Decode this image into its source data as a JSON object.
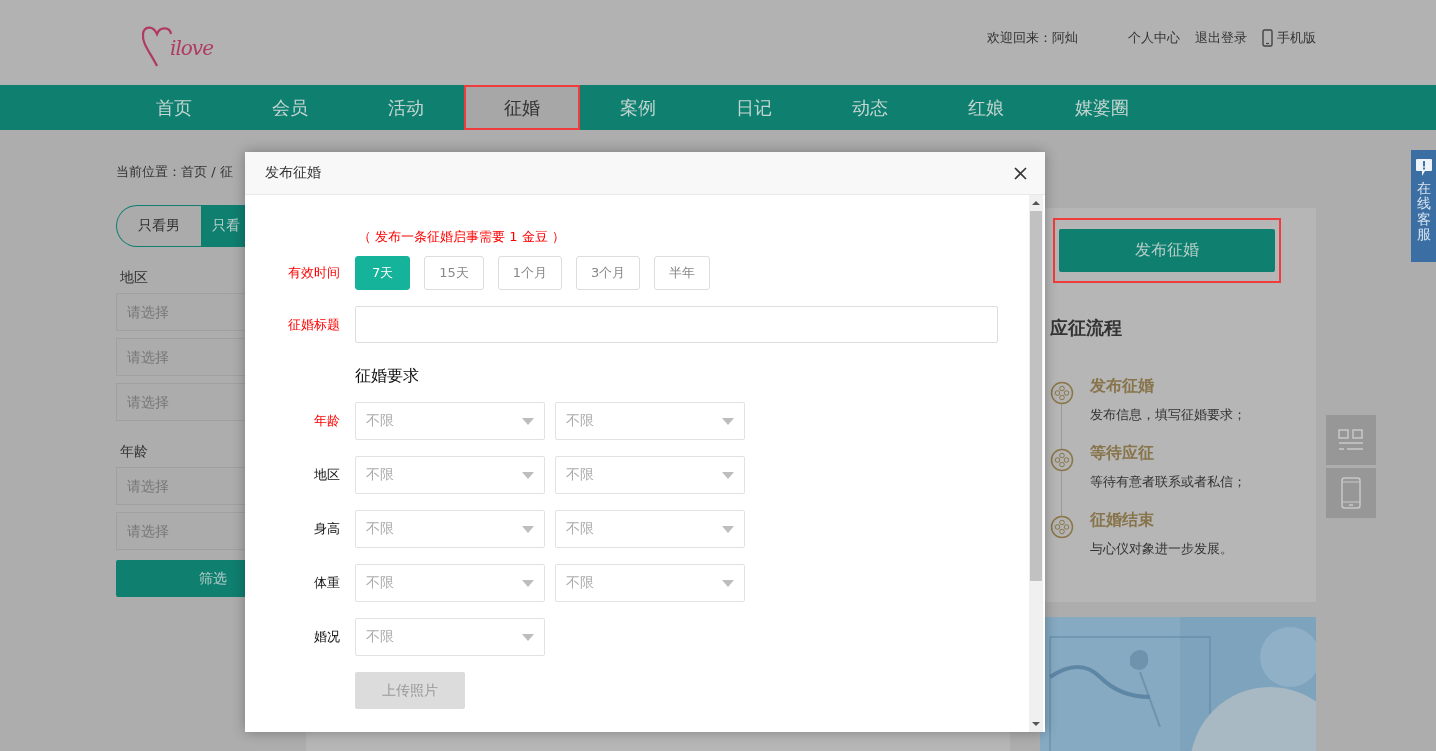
{
  "header": {
    "logo": "ilove",
    "welcome": "欢迎回来：阿灿",
    "links": [
      {
        "label": "个人中心",
        "kind": "text"
      },
      {
        "label": "退出登录",
        "kind": "text"
      },
      {
        "label": "手机版",
        "kind": "mobile"
      }
    ]
  },
  "nav": [
    {
      "label": "首页",
      "selected": false,
      "highlighted": false
    },
    {
      "label": "会员",
      "selected": false,
      "highlighted": false
    },
    {
      "label": "活动",
      "selected": false,
      "highlighted": false
    },
    {
      "label": "征婚",
      "selected": true,
      "highlighted": true
    },
    {
      "label": "案例",
      "selected": false,
      "highlighted": false
    },
    {
      "label": "日记",
      "selected": false,
      "highlighted": false
    },
    {
      "label": "动态",
      "selected": false,
      "highlighted": false
    },
    {
      "label": "红娘",
      "selected": false,
      "highlighted": false
    },
    {
      "label": "媒婆圈",
      "selected": false,
      "highlighted": false
    }
  ],
  "breadcrumb": "当前位置：首页 / 征",
  "filter": {
    "gender_tabs": [
      {
        "label": "只看男",
        "selected": false
      },
      {
        "label": "只看",
        "selected": true
      }
    ],
    "groups": [
      {
        "label": "地区",
        "fields": [
          {
            "placeholder": "请选择"
          },
          {
            "placeholder": "请选择"
          },
          {
            "placeholder": "请选择"
          }
        ]
      },
      {
        "label": "年龄",
        "fields": [
          {
            "placeholder": "请选择"
          },
          {
            "placeholder": "请选择"
          }
        ]
      }
    ],
    "button": "筛选"
  },
  "sidebar": {
    "publish_button": {
      "label": "发布征婚",
      "highlighted": true
    },
    "process_title": "应征流程",
    "steps": [
      {
        "title": "发布征婚",
        "description": "发布信息，填写征婚要求；"
      },
      {
        "title": "等待应征",
        "description": "等待有意者联系或者私信；"
      },
      {
        "title": "征婚结束",
        "description": "与心仪对象进一步发展。"
      }
    ]
  },
  "service_tab": "在线客服",
  "modal": {
    "title": "发布征婚",
    "note": "（ 发布一条征婚启事需要 1 金豆 ）",
    "duration": {
      "label": "有效时间",
      "required": true,
      "options": [
        {
          "label": "7天",
          "selected": true
        },
        {
          "label": "15天",
          "selected": false
        },
        {
          "label": "1个月",
          "selected": false
        },
        {
          "label": "3个月",
          "selected": false
        },
        {
          "label": "半年",
          "selected": false
        }
      ]
    },
    "title_field": {
      "label": "征婚标题",
      "required": true
    },
    "requirements_title": "征婚要求",
    "requirements": [
      {
        "label": "年龄",
        "required": true,
        "selects": [
          {
            "value": "不限"
          },
          {
            "value": "不限"
          }
        ]
      },
      {
        "label": "地区",
        "required": false,
        "selects": [
          {
            "value": "不限"
          },
          {
            "value": "不限"
          }
        ]
      },
      {
        "label": "身高",
        "required": false,
        "selects": [
          {
            "value": "不限"
          },
          {
            "value": "不限"
          }
        ]
      },
      {
        "label": "体重",
        "required": false,
        "selects": [
          {
            "value": "不限"
          },
          {
            "value": "不限"
          }
        ]
      },
      {
        "label": "婚况",
        "required": false,
        "selects": [
          {
            "value": "不限"
          }
        ]
      }
    ],
    "upload_button": "上传照片"
  }
}
